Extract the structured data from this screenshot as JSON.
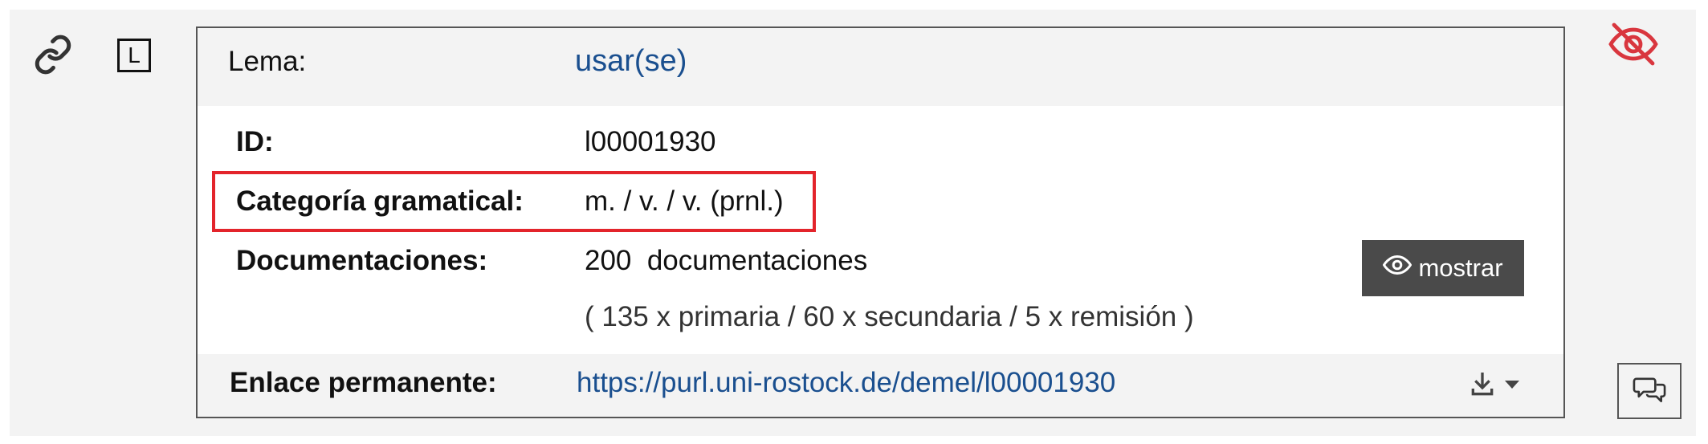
{
  "entry": {
    "lemma_label": "Lema:",
    "lemma_value": "usar(se)",
    "id_label": "ID:",
    "id_value": "l00001930",
    "category_label": "Categoría gramatical:",
    "category_value": "m. / v. / v. (prnl.)",
    "docs_label": "Documentaciones:",
    "docs_value": "200  documentaciones",
    "docs_breakdown": "( 135 x primaria / 60 x secundaria / 5 x remisión )",
    "show_button_label": "mostrar",
    "permalink_label": "Enlace permanente:",
    "permalink_value": "https://purl.uni-rostock.de/demel/l00001930"
  },
  "side_icons": {
    "left": [
      "link-icon",
      "l-box-icon"
    ],
    "right": [
      "eye-off-icon",
      "comment-icon"
    ]
  },
  "colors": {
    "link_blue": "#1a4f8f",
    "highlight_red": "#e3242b",
    "eye_off_red": "#d9363e",
    "button_dark": "#4a4a4a"
  }
}
